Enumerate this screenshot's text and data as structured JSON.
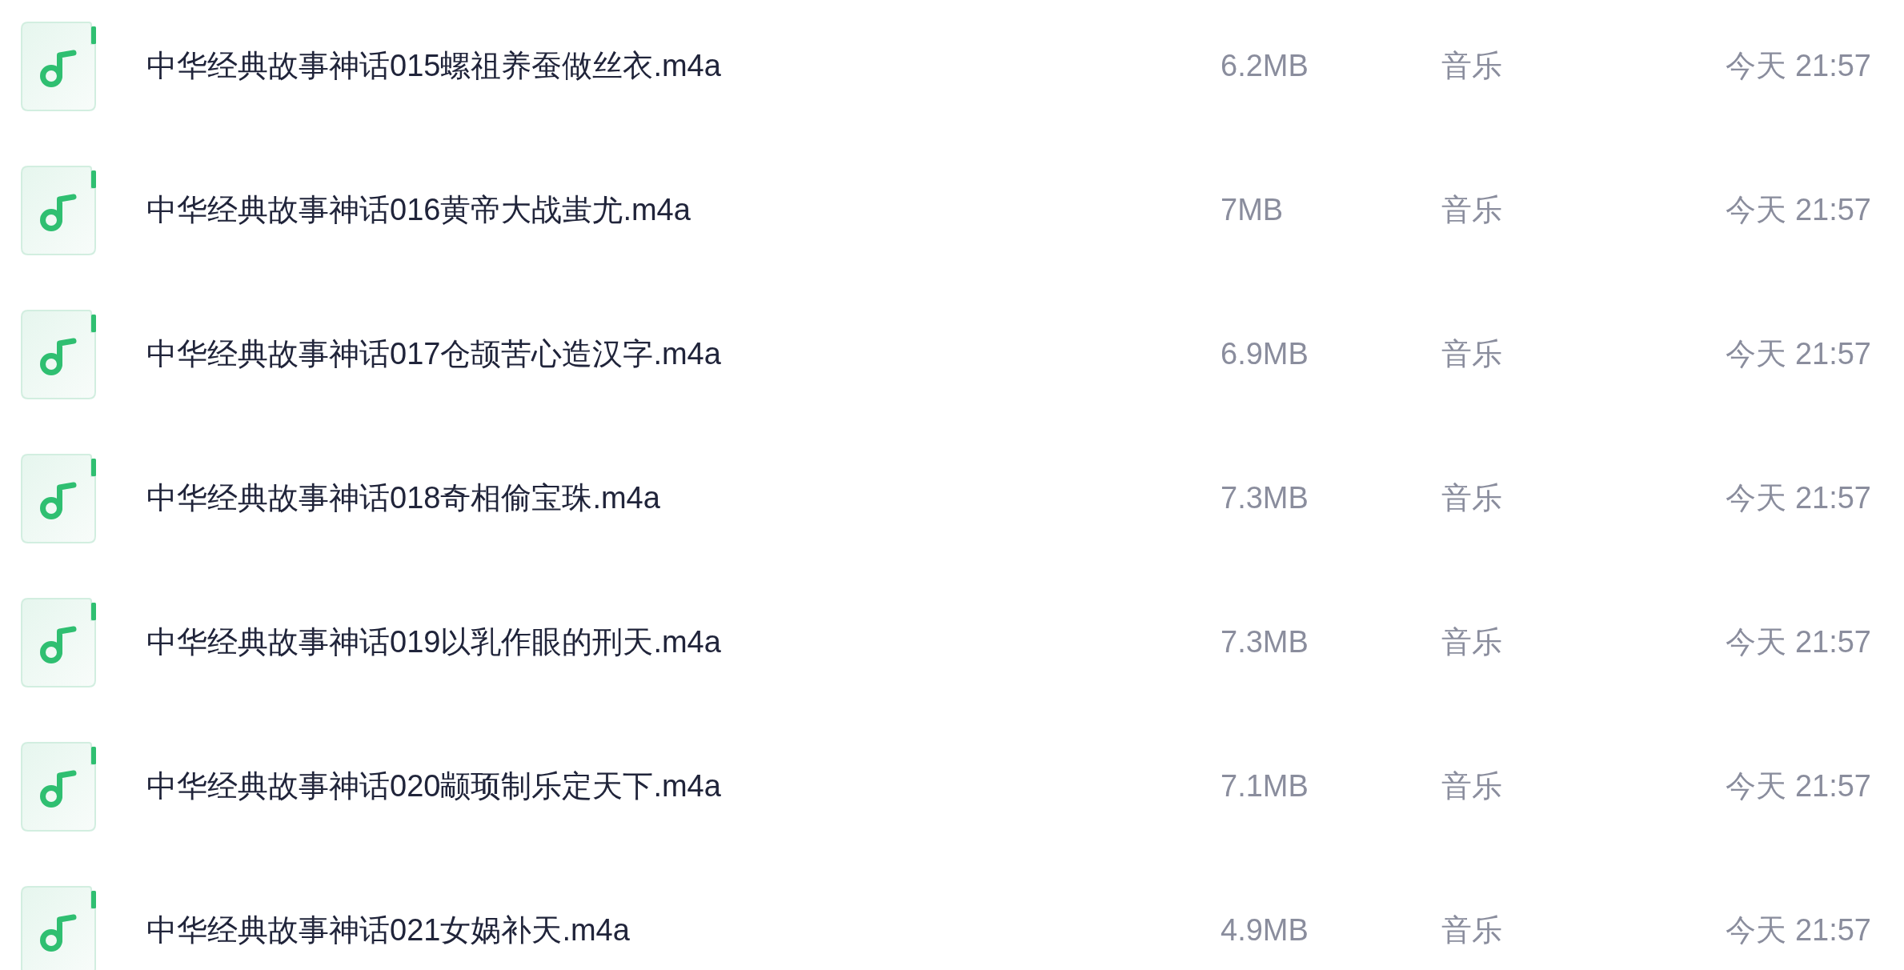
{
  "files": [
    {
      "name": "中华经典故事神话015螺祖养蚕做丝衣.m4a",
      "size": "6.2MB",
      "type": "音乐",
      "modified": "今天 21:57"
    },
    {
      "name": "中华经典故事神话016黄帝大战蚩尤.m4a",
      "size": "7MB",
      "type": "音乐",
      "modified": "今天 21:57"
    },
    {
      "name": "中华经典故事神话017仓颉苦心造汉字.m4a",
      "size": "6.9MB",
      "type": "音乐",
      "modified": "今天 21:57"
    },
    {
      "name": "中华经典故事神话018奇相偷宝珠.m4a",
      "size": "7.3MB",
      "type": "音乐",
      "modified": "今天 21:57"
    },
    {
      "name": "中华经典故事神话019以乳作眼的刑天.m4a",
      "size": "7.3MB",
      "type": "音乐",
      "modified": "今天 21:57"
    },
    {
      "name": "中华经典故事神话020颛顼制乐定天下.m4a",
      "size": "7.1MB",
      "type": "音乐",
      "modified": "今天 21:57"
    },
    {
      "name": "中华经典故事神话021女娲补天.m4a",
      "size": "4.9MB",
      "type": "音乐",
      "modified": "今天 21:57"
    }
  ]
}
